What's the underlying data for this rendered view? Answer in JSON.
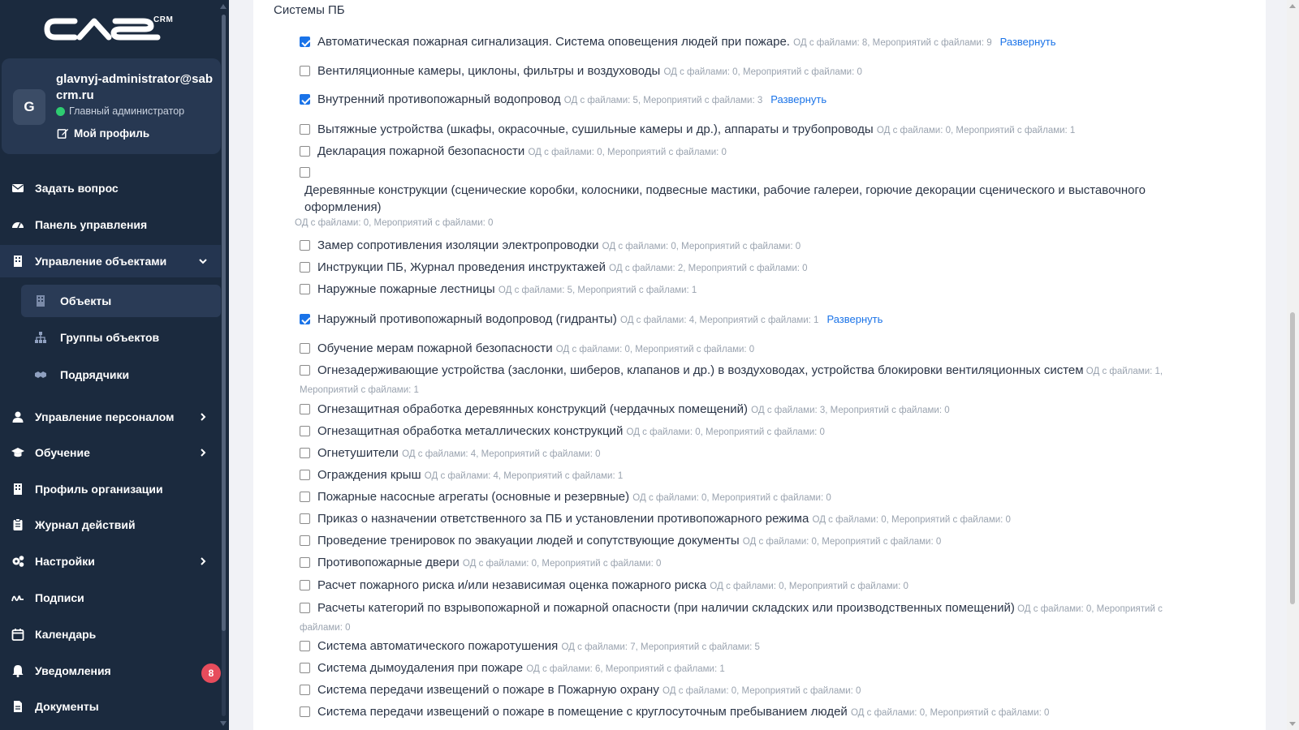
{
  "brand": {
    "crm_label": "CRM"
  },
  "profile": {
    "avatar_letter": "G",
    "email": "glavnyj-administrator@sabcrm.ru",
    "role": "Главный администратор",
    "profile_link": "Мой профиль"
  },
  "nav": {
    "ask": "Задать вопрос",
    "dashboard": "Панель управления",
    "objects_mgmt": "Управление объектами",
    "objects": "Объекты",
    "object_groups": "Группы объектов",
    "contractors": "Подрядчики",
    "staff_mgmt": "Управление персоналом",
    "training": "Обучение",
    "org_profile": "Профиль организации",
    "action_log": "Журнал действий",
    "settings": "Настройки",
    "signatures": "Подписи",
    "calendar": "Календарь",
    "notifications": "Уведомления",
    "notifications_count": "8",
    "documents": "Документы"
  },
  "main": {
    "section_title": "Системы ПБ",
    "expand_label": "Развернуть",
    "items": [
      {
        "label": "Автоматическая пожарная сигнализация. Система оповещения людей при пожаре.",
        "meta": "ОД с файлами: 8, Мероприятий с файлами: 9",
        "checked": true
      },
      {
        "label": "Вентиляционные камеры, циклоны, фильтры и воздуховоды",
        "meta": "ОД с файлами: 0, Мероприятий с файлами: 0",
        "checked": false
      },
      {
        "label": "Внутренний противопожарный водопровод",
        "meta": "ОД с файлами: 5, Мероприятий с файлами: 3",
        "checked": true
      },
      {
        "label": "Вытяжные устройства (шкафы, окрасочные, сушильные камеры и др.), аппараты и трубопроводы",
        "meta": "ОД с файлами: 0, Мероприятий с файлами: 1",
        "checked": false
      },
      {
        "label": "Декларация пожарной безопасности",
        "meta": "ОД с файлами: 0, Мероприятий с файлами: 0",
        "checked": false
      },
      {
        "label": "Деревянные конструкции (сценические коробки, колосники, подвесные мастики, рабочие галереи, горючие декорации сценического и выставочного оформления)",
        "meta": "ОД с файлами: 0, Мероприятий с файлами: 0",
        "checked": false
      },
      {
        "label": "Замер сопротивления изоляции электропроводки",
        "meta": "ОД с файлами: 0, Мероприятий с файлами: 0",
        "checked": false
      },
      {
        "label": "Инструкции ПБ, Журнал проведения инструктажей",
        "meta": "ОД с файлами: 2, Мероприятий с файлами: 0",
        "checked": false
      },
      {
        "label": "Наружные пожарные лестницы",
        "meta": "ОД с файлами: 5, Мероприятий с файлами: 1",
        "checked": false
      },
      {
        "label": "Наружный противопожарный водопровод (гидранты)",
        "meta": "ОД с файлами: 4, Мероприятий с файлами: 1",
        "checked": true
      },
      {
        "label": "Обучение мерам пожарной безопасности",
        "meta": "ОД с файлами: 0, Мероприятий с файлами: 0",
        "checked": false
      },
      {
        "label": "Огнезадерживающие устройства (заслонки, шиберов, клапанов и др.) в воздуховодах, устройства блокировки вентиляционных систем",
        "meta": "ОД с файлами: 1, Мероприятий с файлами: 1",
        "checked": false
      },
      {
        "label": "Огнезащитная обработка деревянных конструкций (чердачных помещений)",
        "meta": "ОД с файлами: 3, Мероприятий с файлами: 0",
        "checked": false
      },
      {
        "label": "Огнезащитная обработка металлических конструкций",
        "meta": "ОД с файлами: 0, Мероприятий с файлами: 0",
        "checked": false
      },
      {
        "label": "Огнетушители",
        "meta": "ОД с файлами: 4, Мероприятий с файлами: 0",
        "checked": false
      },
      {
        "label": "Ограждения крыш",
        "meta": "ОД с файлами: 4, Мероприятий с файлами: 1",
        "checked": false
      },
      {
        "label": "Пожарные насосные агрегаты (основные и резервные)",
        "meta": "ОД с файлами: 0, Мероприятий с файлами: 0",
        "checked": false
      },
      {
        "label": "Приказ о назначении ответственного за ПБ и установлении противопожарного режима",
        "meta": "ОД с файлами: 0, Мероприятий с файлами: 0",
        "checked": false
      },
      {
        "label": "Проведение тренировок по эвакуации людей и сопутствующие документы",
        "meta": "ОД с файлами: 0, Мероприятий с файлами: 0",
        "checked": false
      },
      {
        "label": "Противопожарные двери",
        "meta": "ОД с файлами: 0, Мероприятий с файлами: 0",
        "checked": false
      },
      {
        "label": "Расчет пожарного риска и/или независимая оценка пожарного риска",
        "meta": "ОД с файлами: 0, Мероприятий с файлами: 0",
        "checked": false
      },
      {
        "label": "Расчеты категорий по взрывопожарной и пожарной опасности (при наличии складских или производственных помещений)",
        "meta": "ОД с файлами: 0, Мероприятий с файлами: 0",
        "checked": false
      },
      {
        "label": "Система автоматического пожаротушения",
        "meta": "ОД с файлами: 7, Мероприятий с файлами: 5",
        "checked": false
      },
      {
        "label": "Система дымоудаления при пожаре",
        "meta": "ОД с файлами: 6, Мероприятий с файлами: 1",
        "checked": false
      },
      {
        "label": "Система передачи извещений о пожаре в Пожарную охрану",
        "meta": "ОД с файлами: 0, Мероприятий с файлами: 0",
        "checked": false
      },
      {
        "label": "Система передачи извещений о пожаре в помещение с круглосуточным пребыванием людей",
        "meta": "ОД с файлами: 0, Мероприятий с файлами: 0",
        "checked": false
      }
    ]
  }
}
